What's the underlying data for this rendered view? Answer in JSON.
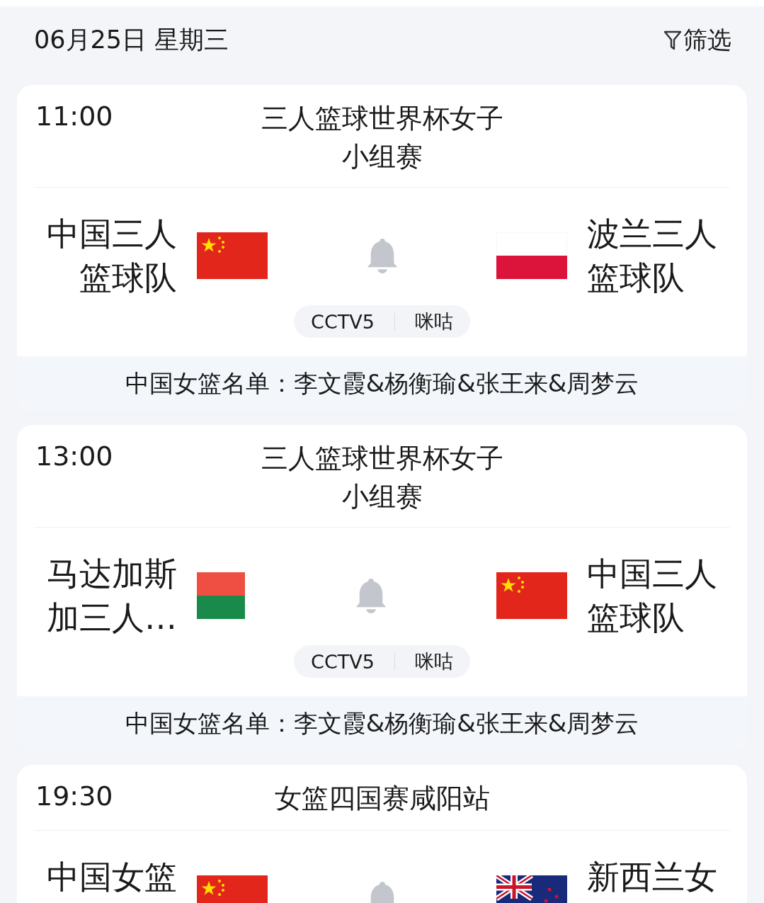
{
  "header": {
    "date": "06月25日 星期三",
    "filter_label": "筛选"
  },
  "matches": [
    {
      "time": "11:00",
      "title": "三人篮球世界杯女子小组赛",
      "home": {
        "name": "中国三人篮球队",
        "flag": {
          "kind": "china"
        }
      },
      "away": {
        "name": "波兰三人篮球队",
        "flag": {
          "kind": "poland"
        }
      },
      "channels": [
        "CCTV5",
        "咪咕"
      ],
      "roster": "中国女篮名单：李文霞&杨衡瑜&张王来&周梦云"
    },
    {
      "time": "13:00",
      "title": "三人篮球世界杯女子小组赛",
      "home": {
        "name": "马达加斯加三人…",
        "flag": {
          "kind": "madagascar"
        }
      },
      "away": {
        "name": "中国三人篮球队",
        "flag": {
          "kind": "china"
        }
      },
      "channels": [
        "CCTV5",
        "咪咕"
      ],
      "roster": "中国女篮名单：李文霞&杨衡瑜&张王来&周梦云"
    },
    {
      "time": "19:30",
      "title": "女篮四国赛咸阳站",
      "home": {
        "name": "中国女篮",
        "flag": {
          "kind": "china"
        }
      },
      "away": {
        "name": "新西兰女",
        "flag": {
          "kind": "newzealand"
        }
      }
    }
  ]
}
